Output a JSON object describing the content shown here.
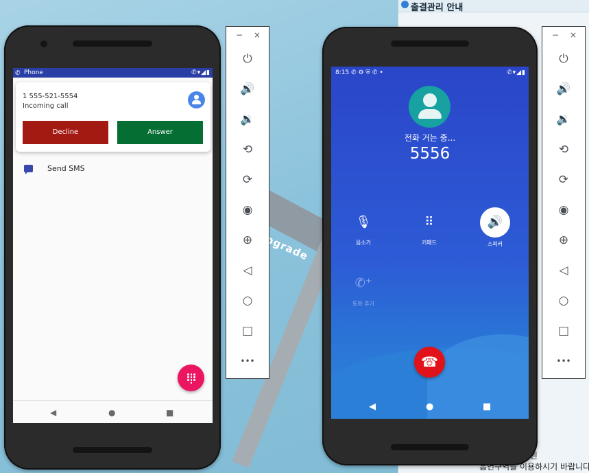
{
  "background": {
    "road_sign_text": "ograde",
    "doc_window": {
      "header_title": "출결관리 안내",
      "footer_line1": "이므로 흡연을 왼",
      "footer_line2": "흡연구역을 이용하시기 바랍니다"
    }
  },
  "left_phone": {
    "status_bar": {
      "app_label": "Phone"
    },
    "incoming_call": {
      "number": "1 555-521-5554",
      "subtitle": "Incoming call",
      "decline_label": "Decline",
      "answer_label": "Answer",
      "decline_color": "#a31a13",
      "answer_color": "#046e33"
    },
    "sms_action_label": "Send SMS",
    "fab_icon": "dialpad-icon",
    "fab_color": "#ec1562",
    "nav": {
      "back": "◀",
      "home": "●",
      "recents": "■"
    }
  },
  "right_phone": {
    "status_bar": {
      "time": "8:15"
    },
    "calling_label": "전화 거는 중...",
    "called_number": "5556",
    "controls": {
      "mute_label": "음소거",
      "keypad_label": "키패드",
      "speaker_label": "스피커",
      "add_call_label": "통화 추가"
    },
    "end_call_color": "#e1121a",
    "nav": {
      "back": "◀",
      "home": "●",
      "recents": "■"
    }
  },
  "toolbar": {
    "minimize": "−",
    "close": "×",
    "items": [
      {
        "name": "power-icon",
        "glyph": "⏻"
      },
      {
        "name": "volume-up-icon",
        "glyph": "🔊"
      },
      {
        "name": "volume-down-icon",
        "glyph": "🔉"
      },
      {
        "name": "rotate-left-icon",
        "glyph": "⟲"
      },
      {
        "name": "rotate-right-icon",
        "glyph": "⟳"
      },
      {
        "name": "camera-icon",
        "glyph": "◉"
      },
      {
        "name": "zoom-icon",
        "glyph": "⊕"
      },
      {
        "name": "back-icon",
        "glyph": "◁"
      },
      {
        "name": "home-icon",
        "glyph": "○"
      },
      {
        "name": "overview-icon",
        "glyph": "□"
      },
      {
        "name": "more-icon",
        "glyph": "•••"
      }
    ]
  }
}
